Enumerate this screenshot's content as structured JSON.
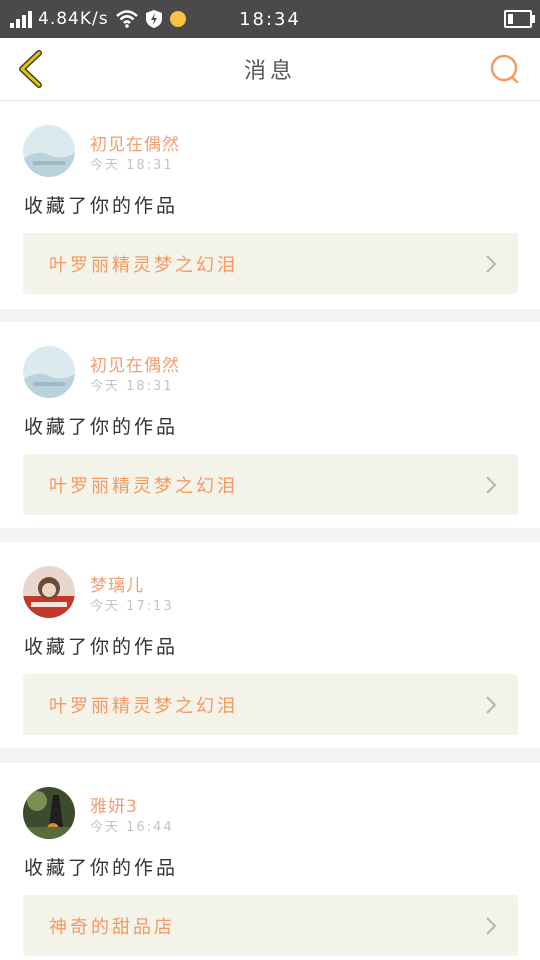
{
  "status_bar": {
    "net_speed": "4.84K/s",
    "time": "18:34"
  },
  "header": {
    "title": "消息"
  },
  "colors": {
    "accent": "#f29a62",
    "back_arrow": "#e8b800",
    "card_link_bg": "#f3f3ea"
  },
  "icons": {
    "back": "back-arrow-icon",
    "search": "search-icon",
    "chevron": "chevron-right-icon"
  },
  "messages": [
    {
      "name": "初见在偶然",
      "time": "今天 18:31",
      "text": "收藏了你的作品",
      "work": "叶罗丽精灵梦之幻泪"
    },
    {
      "name": "初见在偶然",
      "time": "今天 18:31",
      "text": "收藏了你的作品",
      "work": "叶罗丽精灵梦之幻泪"
    },
    {
      "name": "梦璃儿",
      "time": "今天 17:13",
      "text": "收藏了你的作品",
      "work": "叶罗丽精灵梦之幻泪"
    },
    {
      "name": "雅妍3",
      "time": "今天 16:44",
      "text": "收藏了你的作品",
      "work": "神奇的甜品店"
    }
  ]
}
